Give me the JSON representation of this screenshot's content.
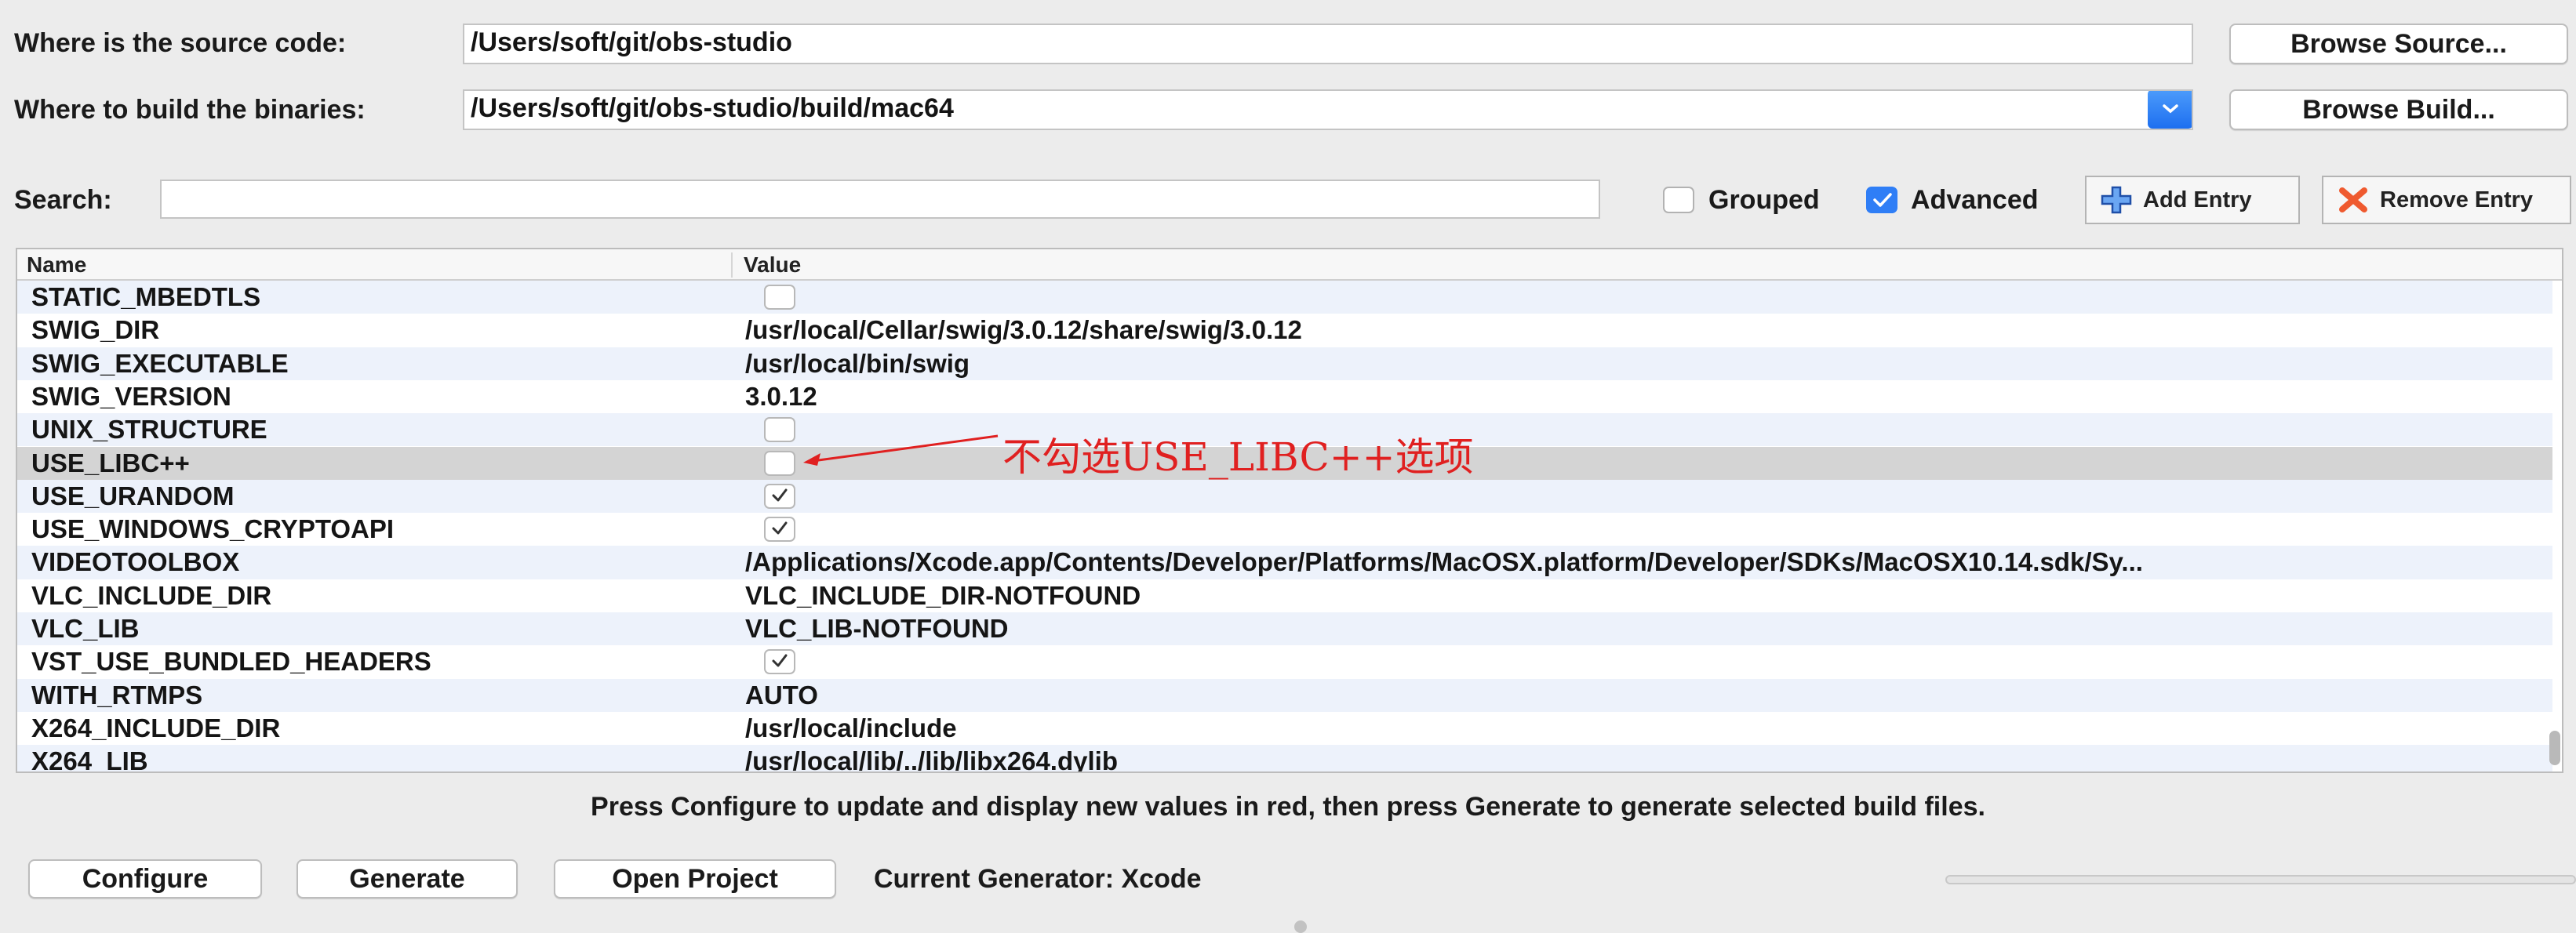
{
  "source": {
    "label": "Where is the source code:",
    "value": "/Users/soft/git/obs-studio",
    "browse_label": "Browse Source..."
  },
  "build": {
    "label": "Where to build the binaries:",
    "value": "/Users/soft/git/obs-studio/build/mac64",
    "browse_label": "Browse Build..."
  },
  "search": {
    "label": "Search:",
    "value": "",
    "placeholder": ""
  },
  "options": {
    "grouped": {
      "label": "Grouped",
      "checked": false
    },
    "advanced": {
      "label": "Advanced",
      "checked": true
    }
  },
  "toolbar": {
    "add_label": "Add Entry",
    "remove_label": "Remove Entry"
  },
  "table": {
    "columns": [
      "Name",
      "Value"
    ],
    "rows": [
      {
        "name": "STATIC_MBEDTLS",
        "type": "bool",
        "checked": false
      },
      {
        "name": "SWIG_DIR",
        "type": "text",
        "value": "/usr/local/Cellar/swig/3.0.12/share/swig/3.0.12"
      },
      {
        "name": "SWIG_EXECUTABLE",
        "type": "text",
        "value": "/usr/local/bin/swig"
      },
      {
        "name": "SWIG_VERSION",
        "type": "text",
        "value": "3.0.12"
      },
      {
        "name": "UNIX_STRUCTURE",
        "type": "bool",
        "checked": false
      },
      {
        "name": "USE_LIBC++",
        "type": "bool",
        "checked": false,
        "selected": true
      },
      {
        "name": "USE_URANDOM",
        "type": "bool",
        "checked": true
      },
      {
        "name": "USE_WINDOWS_CRYPTOAPI",
        "type": "bool",
        "checked": true
      },
      {
        "name": "VIDEOTOOLBOX",
        "type": "text",
        "value": "/Applications/Xcode.app/Contents/Developer/Platforms/MacOSX.platform/Developer/SDKs/MacOSX10.14.sdk/Sy..."
      },
      {
        "name": "VLC_INCLUDE_DIR",
        "type": "text",
        "value": "VLC_INCLUDE_DIR-NOTFOUND"
      },
      {
        "name": "VLC_LIB",
        "type": "text",
        "value": "VLC_LIB-NOTFOUND"
      },
      {
        "name": "VST_USE_BUNDLED_HEADERS",
        "type": "bool",
        "checked": true
      },
      {
        "name": "WITH_RTMPS",
        "type": "text",
        "value": "AUTO"
      },
      {
        "name": "X264_INCLUDE_DIR",
        "type": "text",
        "value": "/usr/local/include"
      },
      {
        "name": "X264_LIB",
        "type": "text",
        "value": "/usr/local/lib/../lib/libx264.dylib"
      }
    ]
  },
  "annotation": {
    "text": "不勾选USE_LIBC++选项",
    "color": "#e02020"
  },
  "hint": "Press Configure to update and display new values in red, then press Generate to generate selected build files.",
  "footer": {
    "configure_label": "Configure",
    "generate_label": "Generate",
    "open_project_label": "Open Project",
    "generator_text": "Current Generator: Xcode"
  },
  "colors": {
    "accent": "#2f7ef6",
    "selected_row": "#d4d4d4",
    "alt_row": "#edf2fb"
  }
}
